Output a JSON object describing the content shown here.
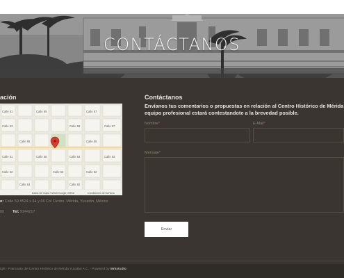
{
  "hero": {
    "title": "CONTÁCTANOS"
  },
  "location": {
    "heading": "ación",
    "map": {
      "streets": [
        "Calle 61",
        "Calle 59",
        "Calle 57",
        "Calle 63",
        "Calle 65",
        "Calle 54",
        "Calle 56",
        "Calle 58",
        "Calle 60",
        "Calle 62",
        "Calle 64",
        "Calle 66",
        "Calle 52",
        "Calle 55",
        "Calle 53"
      ],
      "attribution": "Datos del mapa ©2015 Google, INEGI",
      "terms": "Condiciones del servicio",
      "marker_color": "#d93a2e"
    },
    "address_label": "o:",
    "address_value": "Calle 59 #524 x 64 y 66 Col Centro, Mérida, Yucatán, México",
    "phone_prefix": "00",
    "phone_label": "Tel:",
    "phone_value": "9244217"
  },
  "contact": {
    "heading": "Contáctanos",
    "intro_line1": "Envíanos tus comentarios o propuestas en relación al Centro Histórico de Mérida",
    "intro_line2": "equipo profesional estará contestandote a la brevedad posible.",
    "name_label": "Nombre",
    "email_label": "E-Mail",
    "message_label": "Mensaje",
    "required_mark": "*",
    "send_label": "Enviar"
  },
  "footer": {
    "prefix": "ight - Patronato del Centro Histórico de Mérida Yucatán A.C. - Powered by",
    "brand": "Mrkstudio"
  },
  "colors": {
    "background": "#3a3530",
    "footer": "#2f2b27",
    "text_light": "#e8e4de",
    "text_muted": "#8b847a",
    "required": "#b66a3a"
  }
}
